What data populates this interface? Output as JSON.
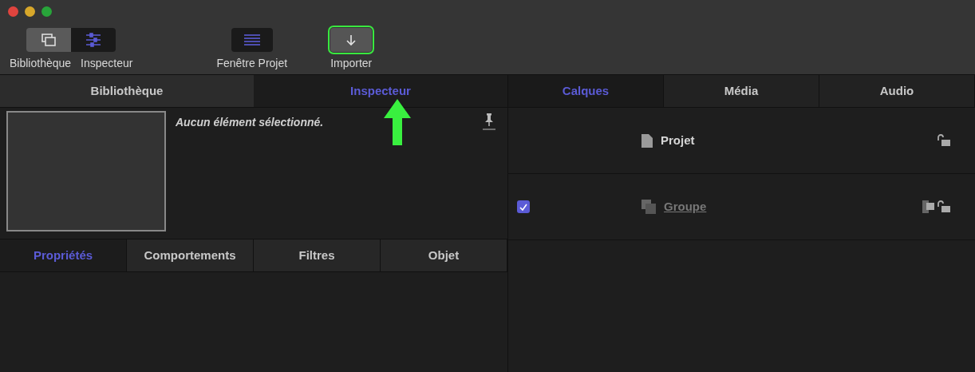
{
  "toolbar": {
    "view_switch": [
      {
        "label": "Bibliothèque",
        "selected": false,
        "kind": "library"
      },
      {
        "label": "Inspecteur",
        "selected": true,
        "kind": "sliders"
      }
    ],
    "buttons": [
      {
        "label": "Fenêtre Projet",
        "on": true,
        "kind": "lines",
        "highlighted": false
      },
      {
        "label": "Importer",
        "on": false,
        "kind": "down",
        "highlighted": true
      }
    ]
  },
  "left_panel": {
    "tabs": [
      {
        "label": "Bibliothèque",
        "selected": false
      },
      {
        "label": "Inspecteur",
        "selected": true
      }
    ],
    "message": "Aucun élément sélectionné.",
    "subtabs": [
      {
        "label": "Propriétés",
        "selected": true
      },
      {
        "label": "Comportements",
        "selected": false
      },
      {
        "label": "Filtres",
        "selected": false
      },
      {
        "label": "Objet",
        "selected": false
      }
    ]
  },
  "right_panel": {
    "tabs": [
      {
        "label": "Calques",
        "selected": true
      },
      {
        "label": "Média",
        "selected": false
      },
      {
        "label": "Audio",
        "selected": false
      }
    ],
    "layers": [
      {
        "kind": "project",
        "name": "Projet"
      },
      {
        "kind": "group",
        "name": "Groupe",
        "checked": true
      }
    ]
  }
}
